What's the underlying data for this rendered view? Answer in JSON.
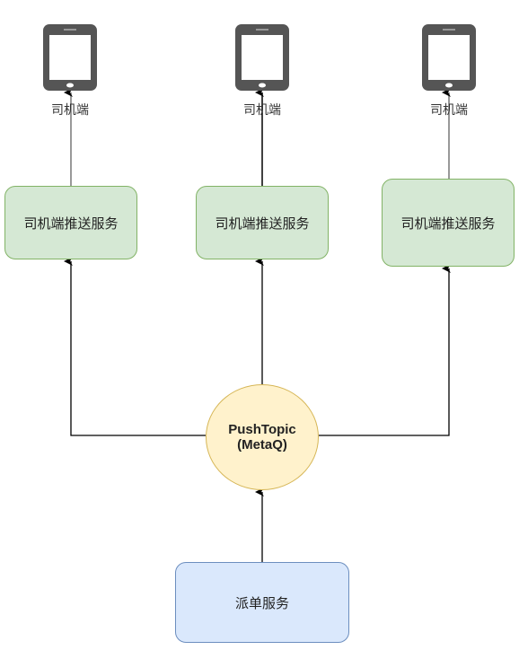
{
  "clients": [
    {
      "label": "司机端",
      "icon": "tablet-icon"
    },
    {
      "label": "司机端",
      "icon": "tablet-icon"
    },
    {
      "label": "司机端",
      "icon": "tablet-icon"
    }
  ],
  "push_services": [
    {
      "label": "司机端推送服务"
    },
    {
      "label": "司机端推送服务"
    },
    {
      "label": "司机端推送服务"
    }
  ],
  "topic": {
    "line1": "PushTopic",
    "line2": "(MetaQ)"
  },
  "dispatch": {
    "label": "派单服务"
  },
  "colors": {
    "green_fill": "#d5e8d4",
    "green_stroke": "#82b366",
    "yellow_fill": "#fff2cc",
    "yellow_stroke": "#d6b656",
    "blue_fill": "#dae8fc",
    "blue_stroke": "#6c8ebf"
  }
}
